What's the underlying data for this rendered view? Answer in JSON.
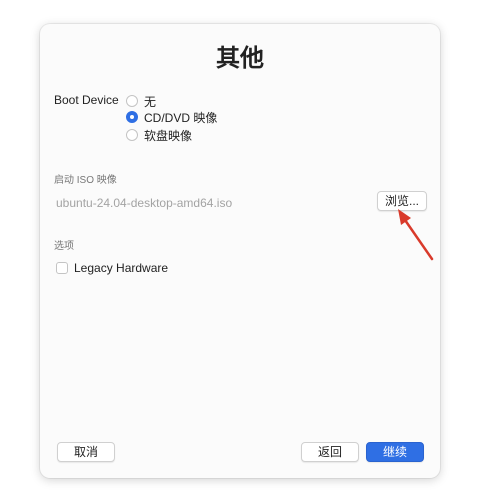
{
  "dialog": {
    "title": "其他",
    "boot_device": {
      "label": "Boot Device",
      "options": [
        {
          "label": "无",
          "checked": false
        },
        {
          "label": "CD/DVD 映像",
          "checked": true
        },
        {
          "label": "软盘映像",
          "checked": false
        }
      ]
    },
    "iso_section": {
      "title": "启动 ISO 映像",
      "path": "ubuntu-24.04-desktop-amd64.iso",
      "browse_label": "浏览..."
    },
    "options_section": {
      "title": "选项",
      "legacy_hardware": {
        "label": "Legacy Hardware",
        "checked": false
      }
    },
    "buttons": {
      "cancel": "取消",
      "back": "返回",
      "continue": "继续"
    }
  },
  "colors": {
    "accent": "#2f6fe4",
    "annotation_arrow": "#d93a2b"
  }
}
